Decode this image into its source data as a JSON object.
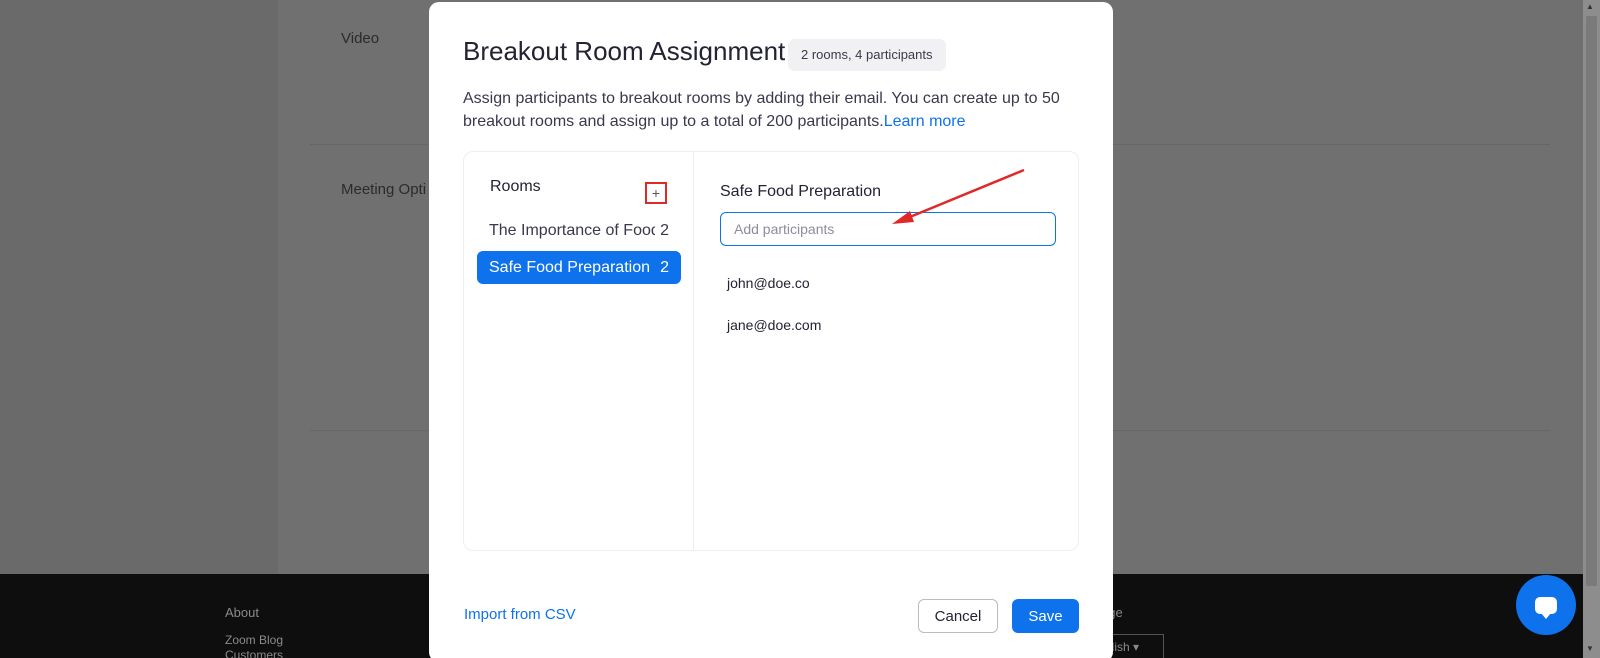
{
  "background": {
    "sections": [
      "Video",
      "Meeting Opti"
    ],
    "footer": {
      "about_heading": "About",
      "links": [
        "Zoom Blog",
        "Customers"
      ],
      "language_heading": "age",
      "language_value": "glish"
    }
  },
  "modal": {
    "title": "Breakout Room Assignment",
    "badge": "2 rooms, 4 participants",
    "description": "Assign participants to breakout rooms by adding their email. You can create up to 50 breakout rooms and assign up to a total of 200 participants.",
    "learn_more": "Learn more",
    "rooms": {
      "heading": "Rooms",
      "add_icon": "plus-icon",
      "items": [
        {
          "name": "The Importance of Food Safety",
          "count": "2"
        },
        {
          "name": "Safe Food Preparation",
          "count": "2"
        }
      ]
    },
    "detail": {
      "title": "Safe Food Preparation",
      "input_placeholder": "Add participants",
      "participants": [
        "john@doe.co",
        "jane@doe.com"
      ]
    },
    "footer": {
      "import_label": "Import from CSV",
      "cancel_label": "Cancel",
      "save_label": "Save"
    }
  },
  "colors": {
    "accent": "#0e72ed",
    "annotation": "#e02828"
  }
}
